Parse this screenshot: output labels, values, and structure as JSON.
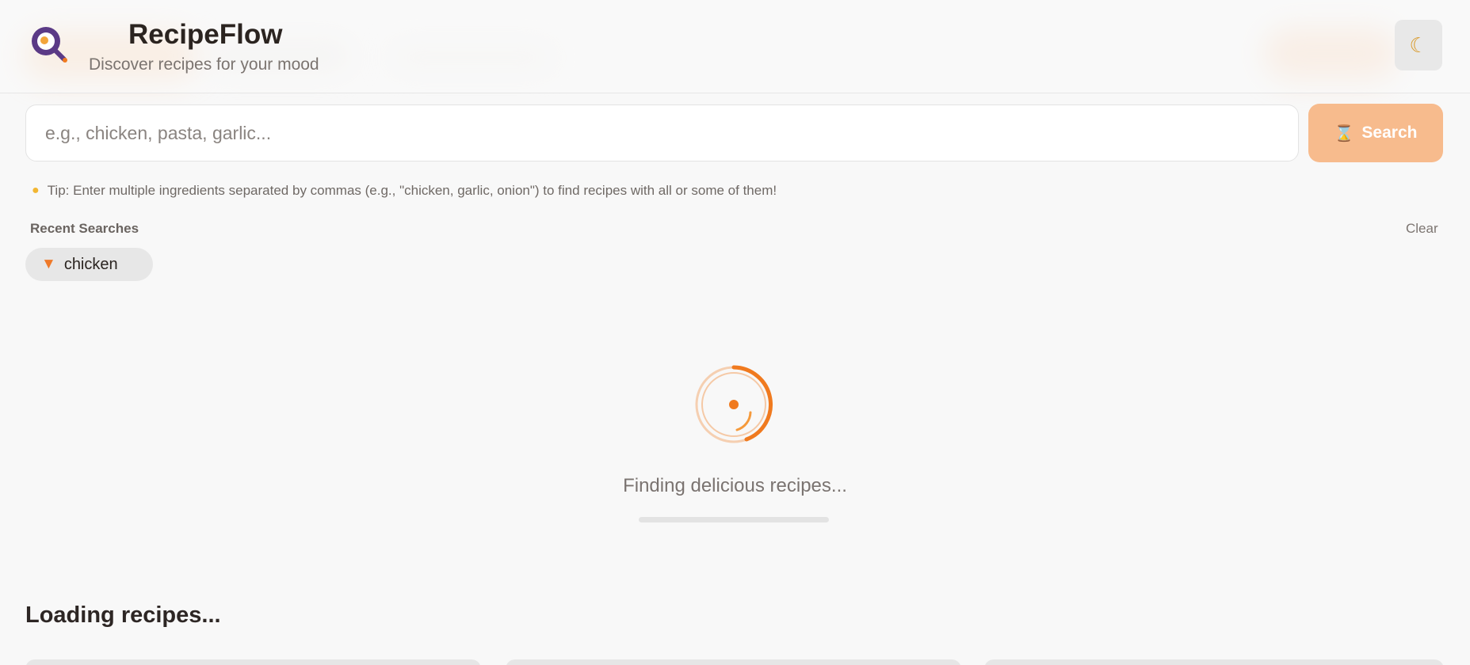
{
  "header": {
    "title": "RecipeFlow",
    "subtitle": "Discover recipes for your mood",
    "logo_icon": "frying-pan-egg-icon",
    "theme_toggle_icon": "crescent-moon-icon",
    "theme_toggle_glyph": "☾"
  },
  "search": {
    "placeholder": "e.g., chicken, pasta, garlic...",
    "value": "",
    "button_label": "Search",
    "button_icon": "hourglass-icon",
    "button_glyph": "⌛"
  },
  "tip": {
    "icon": "lightbulb-icon",
    "glyph": "●",
    "text": "Tip: Enter multiple ingredients separated by commas (e.g., \"chicken, garlic, onion\") to find recipes with all or some of them!"
  },
  "recent": {
    "label": "Recent Searches",
    "clear_label": "Clear",
    "items": [
      {
        "icon": "carrot-icon",
        "glyph": "▼",
        "label": "chicken"
      }
    ]
  },
  "loading": {
    "text": "Finding delicious recipes...",
    "progress": 0.0
  },
  "results": {
    "title": "Loading recipes..."
  },
  "colors": {
    "accent": "#f07a1f",
    "accent_light": "#f7bb8d",
    "background": "#f8f8f8"
  }
}
